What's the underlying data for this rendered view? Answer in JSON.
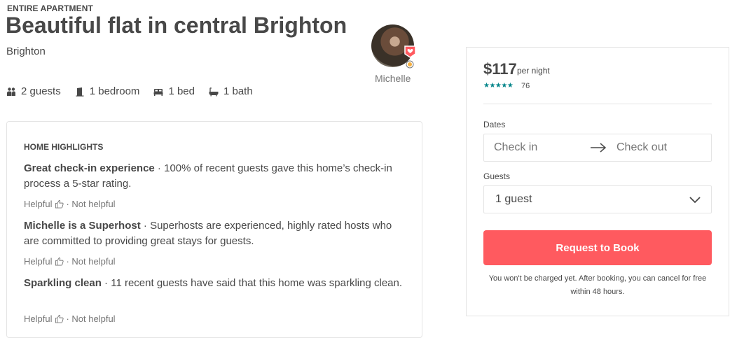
{
  "listing": {
    "kind": "ENTIRE APARTMENT",
    "title": "Beautiful flat in central Brighton",
    "city": "Brighton"
  },
  "host": {
    "name": "Michelle"
  },
  "facts": [
    {
      "icon": "guests-icon",
      "label": "2 guests"
    },
    {
      "icon": "door-icon",
      "label": "1 bedroom"
    },
    {
      "icon": "bed-icon",
      "label": "1 bed"
    },
    {
      "icon": "bath-icon",
      "label": "1 bath"
    }
  ],
  "highlights": {
    "heading": "HOME HIGHLIGHTS",
    "items": [
      {
        "title": "Great check-in experience",
        "sep": " · ",
        "text": "100% of recent guests gave this home’s check-in process a 5-star rating."
      },
      {
        "title": "Michelle is a Superhost",
        "sep": " · ",
        "text": "Superhosts are experienced, highly rated hosts who are committed to providing great stays for guests."
      },
      {
        "title": "Sparkling clean",
        "sep": " · ",
        "text": "11 recent guests have said that this home was sparkling clean."
      }
    ],
    "helpful_label": "Helpful",
    "not_helpful_label": "· Not helpful"
  },
  "booking": {
    "price": "$117",
    "per": "per night",
    "stars": "★★★★★",
    "review_count": "76",
    "dates_label": "Dates",
    "check_in": "Check in",
    "check_out": "Check out",
    "guests_label": "Guests",
    "guests_value": "1 guest",
    "button": "Request to Book",
    "notice": "You won't be charged yet. After booking, you can cancel for free within 48 hours."
  },
  "colors": {
    "accent": "#ff5a5f",
    "stars": "#008489",
    "text": "#484848",
    "muted": "#767676"
  }
}
